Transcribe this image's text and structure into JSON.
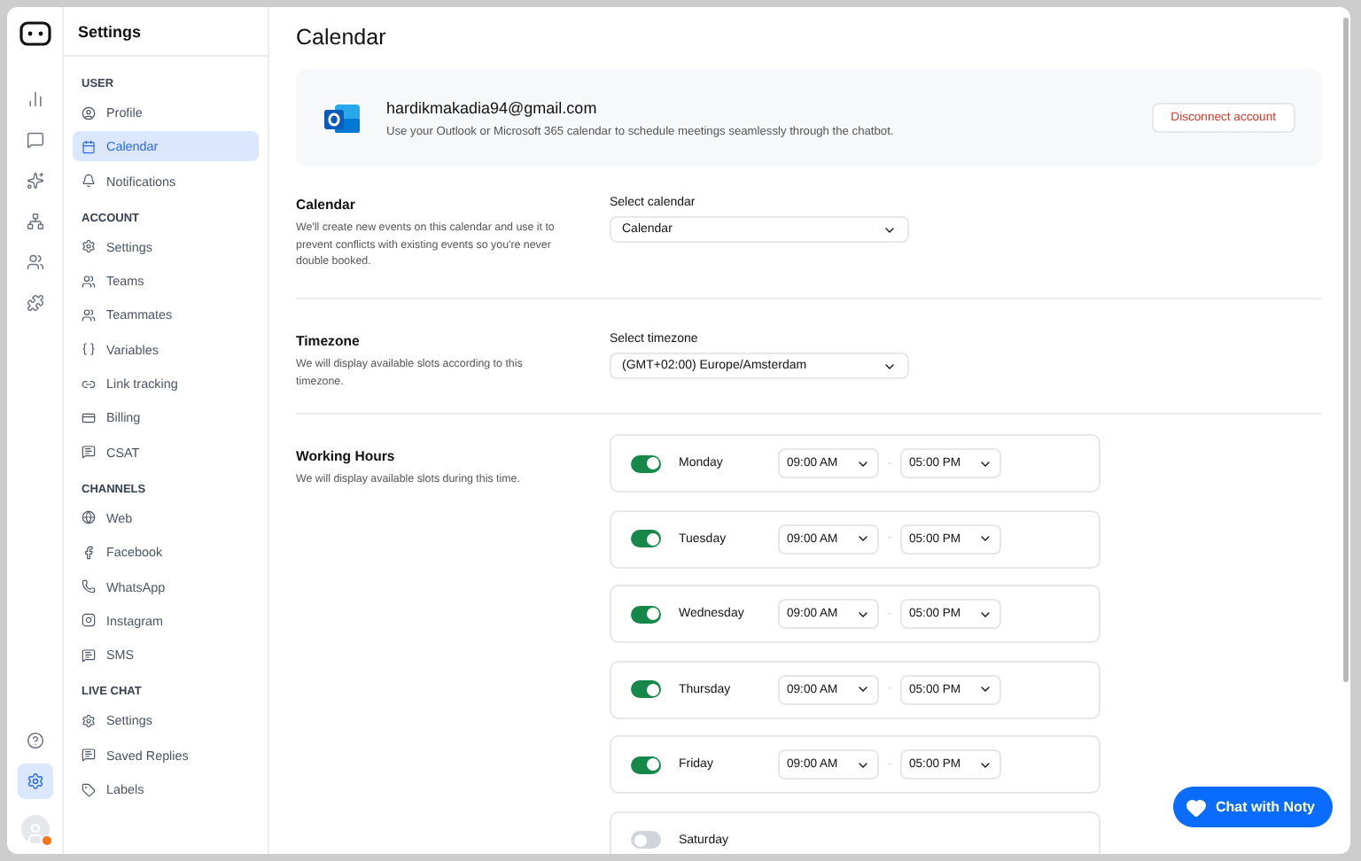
{
  "sidebar": {
    "title": "Settings",
    "sections": [
      {
        "heading": "USER",
        "items": [
          {
            "label": "Profile",
            "selected": false
          },
          {
            "label": "Calendar",
            "selected": true
          },
          {
            "label": "Notifications",
            "selected": false
          }
        ]
      },
      {
        "heading": "ACCOUNT",
        "items": [
          {
            "label": "Settings",
            "selected": false
          },
          {
            "label": "Teams",
            "selected": false
          },
          {
            "label": "Teammates",
            "selected": false
          },
          {
            "label": "Variables",
            "selected": false
          },
          {
            "label": "Link tracking",
            "selected": false
          },
          {
            "label": "Billing",
            "selected": false
          },
          {
            "label": "CSAT",
            "selected": false
          }
        ]
      },
      {
        "heading": "CHANNELS",
        "items": [
          {
            "label": "Web",
            "selected": false
          },
          {
            "label": "Facebook",
            "selected": false
          },
          {
            "label": "WhatsApp",
            "selected": false
          },
          {
            "label": "Instagram",
            "selected": false
          },
          {
            "label": "SMS",
            "selected": false
          }
        ]
      },
      {
        "heading": "LIVE CHAT",
        "items": [
          {
            "label": "Settings",
            "selected": false
          },
          {
            "label": "Saved Replies",
            "selected": false
          },
          {
            "label": "Labels",
            "selected": false
          }
        ]
      }
    ]
  },
  "rail": {
    "items": [
      {
        "selected": false
      },
      {
        "selected": false
      },
      {
        "selected": false
      },
      {
        "selected": false
      },
      {
        "selected": false
      },
      {
        "selected": false
      }
    ],
    "bottom": [
      {
        "selected": false
      },
      {
        "selected": true
      }
    ],
    "avatar": {
      "online": true
    }
  },
  "page": {
    "title": "Calendar"
  },
  "account": {
    "email": "hardikmakadia94@gmail.com",
    "description": "Use your Outlook or Microsoft 365 calendar to schedule meetings seamlessly through the chatbot.",
    "button": "Disconnect account"
  },
  "settings": [
    {
      "title": "Calendar",
      "description": "We'll create new events on this calendar and use it to prevent conflicts with existing events so you're never double booked.",
      "field_label": "Select calendar",
      "value": "Calendar"
    },
    {
      "title": "Timezone",
      "description": "We will display available slots according to this timezone.",
      "field_label": "Select timezone",
      "value": "(GMT+02:00) Europe/Amsterdam"
    }
  ],
  "working_hours": {
    "title": "Working Hours",
    "description": "We will display available slots during this time.",
    "days": [
      {
        "day": "Monday",
        "on": true,
        "start": "09:00 AM",
        "separator": "-",
        "end": "05:00 PM"
      },
      {
        "day": "Tuesday",
        "on": true,
        "start": "09:00 AM",
        "separator": "-",
        "end": "05:00 PM"
      },
      {
        "day": "Wednesday",
        "on": true,
        "start": "09:00 AM",
        "separator": "-",
        "end": "05:00 PM"
      },
      {
        "day": "Thursday",
        "on": true,
        "start": "09:00 AM",
        "separator": "-",
        "end": "05:00 PM"
      },
      {
        "day": "Friday",
        "on": true,
        "start": "09:00 AM",
        "separator": "-",
        "end": "05:00 PM"
      },
      {
        "day": "Saturday",
        "on": false
      }
    ]
  },
  "chat_button": {
    "label": "Chat with Noty"
  }
}
